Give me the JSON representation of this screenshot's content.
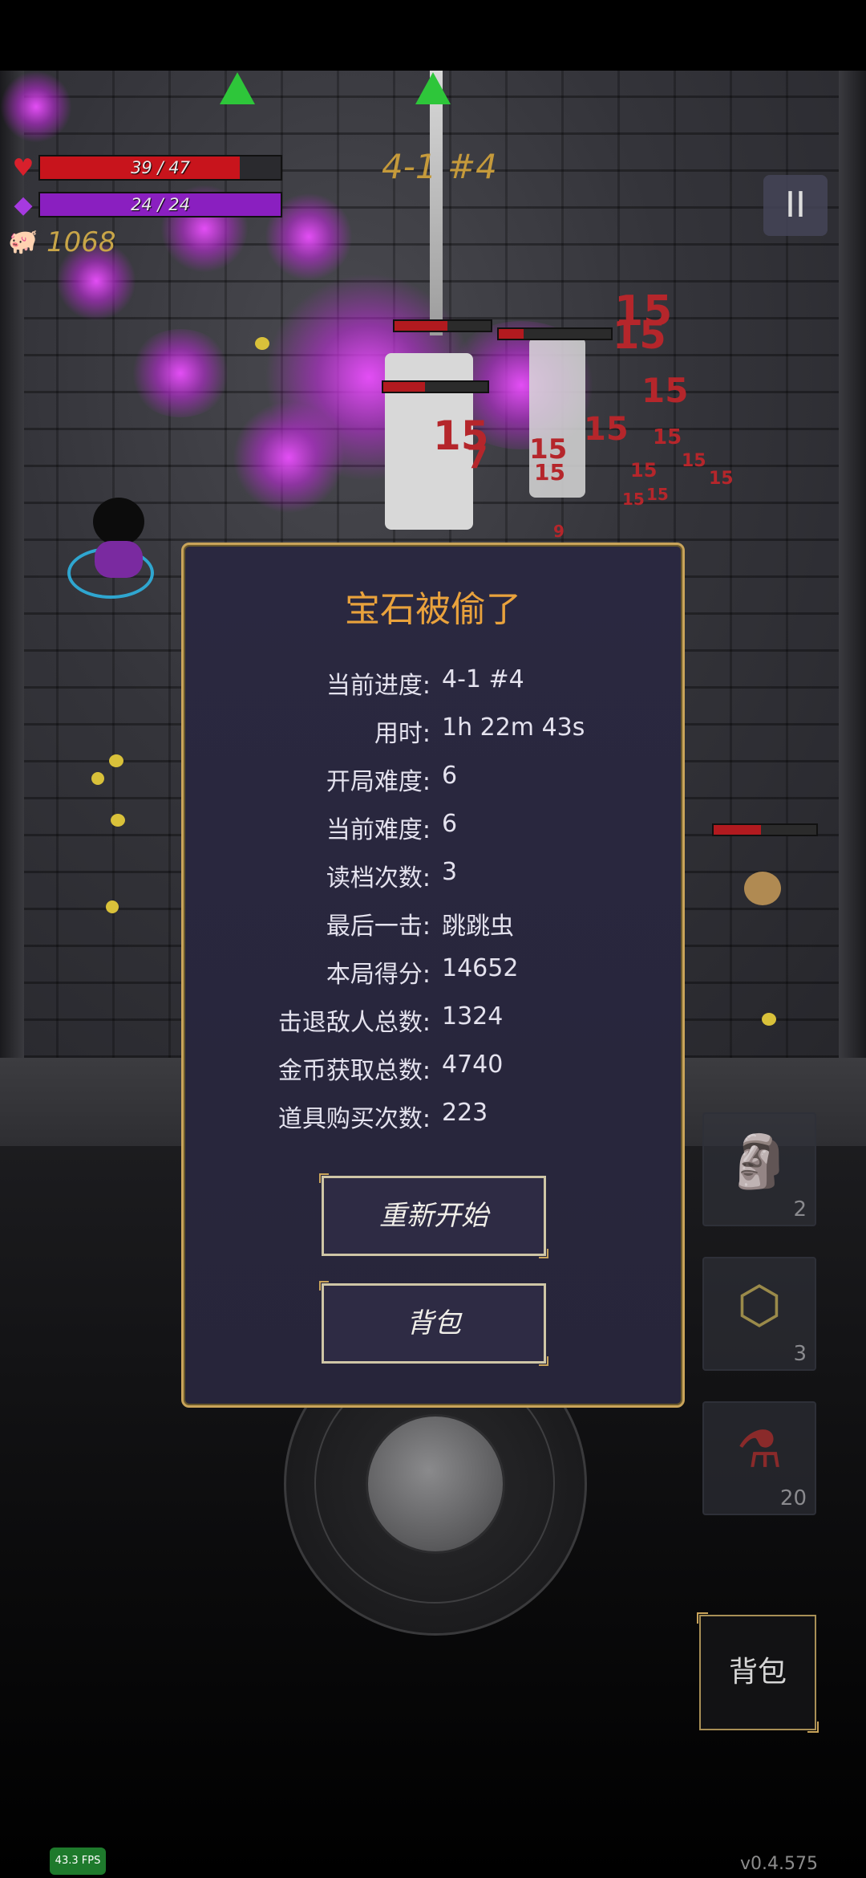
{
  "hud": {
    "hp_text": "39 / 47",
    "hp_fraction": 0.83,
    "mana_text": "24 / 24",
    "mana_fraction": 1.0,
    "gold": "1068",
    "stage": "4-1 #4",
    "pause_icon": "pause-icon"
  },
  "floating_damage": [
    "15",
    "15",
    "15",
    "15",
    "15",
    "7",
    "15",
    "15",
    "15",
    "15",
    "15",
    "15",
    "15",
    "15",
    "9"
  ],
  "modal": {
    "title": "宝石被偷了",
    "stats": [
      {
        "label": "当前进度:",
        "value": "4-1 #4"
      },
      {
        "label": "用时:",
        "value": "1h 22m 43s"
      },
      {
        "label": "开局难度:",
        "value": "6"
      },
      {
        "label": "当前难度:",
        "value": "6"
      },
      {
        "label": "读档次数:",
        "value": "3"
      },
      {
        "label": "最后一击:",
        "value": "跳跳虫"
      },
      {
        "label": "本局得分:",
        "value": "14652"
      },
      {
        "label": "击退敌人总数:",
        "value": "1324"
      },
      {
        "label": "金币获取总数:",
        "value": "4740"
      },
      {
        "label": "道具购买次数:",
        "value": "223"
      }
    ],
    "restart_label": "重新开始",
    "bag_label": "背包"
  },
  "items": [
    {
      "icon": "statue-icon",
      "count": "2"
    },
    {
      "icon": "crystal-icon",
      "count": "3"
    },
    {
      "icon": "potion-icon",
      "count": "20"
    }
  ],
  "bag_button_label": "背包",
  "fps": "43.3 FPS",
  "version": "v0.4.575",
  "colors": {
    "hp": "#c8141c",
    "mana": "#8a1fc0",
    "accent_gold": "#c9a45a",
    "title_orange": "#e9a23c"
  }
}
